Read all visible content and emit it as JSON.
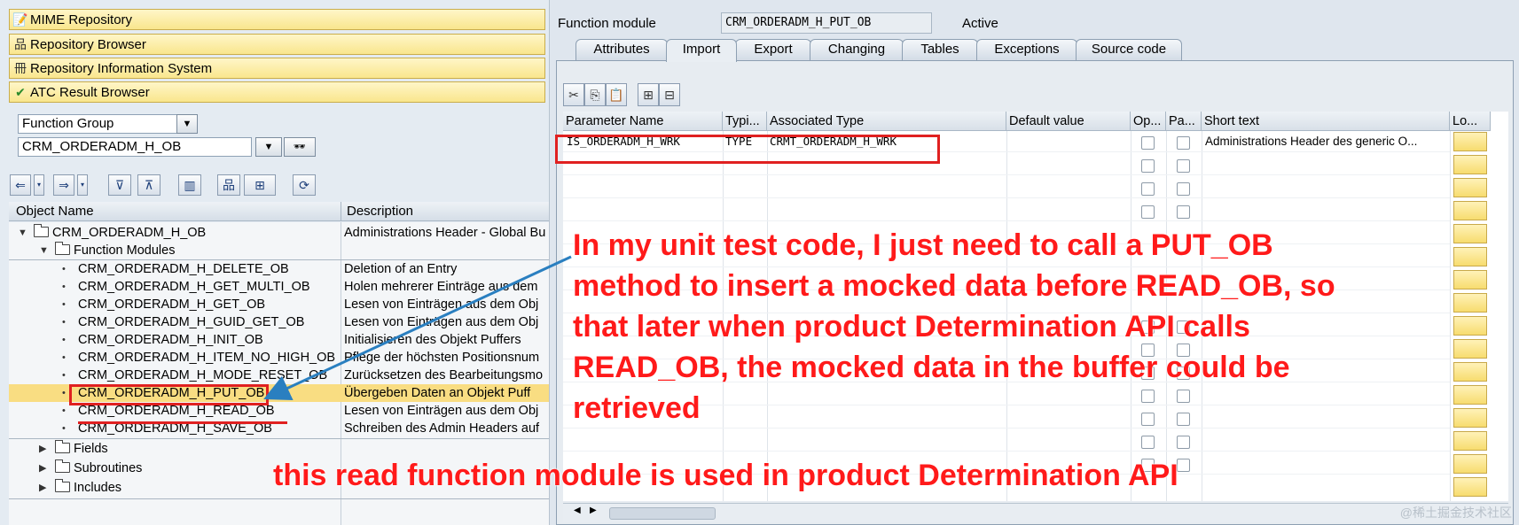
{
  "nav": {
    "items": [
      {
        "label": "MIME Repository",
        "icon": "mime-repository-icon",
        "glyph": "📝"
      },
      {
        "label": "Repository Browser",
        "icon": "repository-browser-icon",
        "glyph": "品"
      },
      {
        "label": "Repository Information System",
        "icon": "repository-info-system-icon",
        "glyph": "冊"
      },
      {
        "label": "ATC Result Browser",
        "icon": "atc-result-icon",
        "glyph": "✔"
      }
    ]
  },
  "object_selector": {
    "type_value": "Function Group",
    "name_value": "CRM_ORDERADM_H_OB",
    "display_glyph": "🕶"
  },
  "tree_toolbar": {
    "buttons": [
      "⇐",
      "⇒",
      "⊽",
      "⊼",
      "▥",
      "品",
      "⊞",
      "⟳"
    ]
  },
  "tree": {
    "header": {
      "col1": "Object Name",
      "col2": "Description"
    },
    "root": {
      "name": "CRM_ORDERADM_H_OB",
      "desc": "Administrations Header - Global Bu"
    },
    "fm_folder": {
      "name": "Function Modules"
    },
    "modules": [
      {
        "name": "CRM_ORDERADM_H_DELETE_OB",
        "desc": "Deletion of an Entry"
      },
      {
        "name": "CRM_ORDERADM_H_GET_MULTI_OB",
        "desc": "Holen mehrerer Einträge aus dem"
      },
      {
        "name": "CRM_ORDERADM_H_GET_OB",
        "desc": "Lesen von Einträgen aus dem Obj"
      },
      {
        "name": "CRM_ORDERADM_H_GUID_GET_OB",
        "desc": "Lesen von Einträgen aus dem Obj"
      },
      {
        "name": "CRM_ORDERADM_H_INIT_OB",
        "desc": "Initialisieren des Objekt Puffers"
      },
      {
        "name": "CRM_ORDERADM_H_ITEM_NO_HIGH_OB",
        "desc": "Pflege der höchsten Positionsnum"
      },
      {
        "name": "CRM_ORDERADM_H_MODE_RESET_OB",
        "desc": "Zurücksetzen des Bearbeitungsmo"
      },
      {
        "name": "CRM_ORDERADM_H_PUT_OB",
        "desc": "Übergeben Daten an Objekt Puff"
      },
      {
        "name": "CRM_ORDERADM_H_READ_OB",
        "desc": "Lesen von Einträgen aus dem Obj"
      },
      {
        "name": "CRM_ORDERADM_H_SAVE_OB",
        "desc": "Schreiben des Admin Headers auf"
      }
    ],
    "other_folders": [
      "Fields",
      "Subroutines",
      "Includes"
    ]
  },
  "function_module": {
    "label": "Function module",
    "value": "CRM_ORDERADM_H_PUT_OB",
    "status": "Active"
  },
  "tabs": [
    "Attributes",
    "Import",
    "Export",
    "Changing",
    "Tables",
    "Exceptions",
    "Source code"
  ],
  "grid_toolbar": [
    "✂",
    "⎘",
    "📋",
    "⊞",
    "⊟"
  ],
  "grid": {
    "columns": [
      "Parameter Name",
      "Typi...",
      "Associated Type",
      "Default value",
      "Op...",
      "Pa...",
      "Short text",
      "Lo..."
    ],
    "rows": [
      {
        "param": "IS_ORDERADM_H_WRK",
        "typing": "TYPE",
        "assoc": "CRMT_ORDERADM_H_WRK",
        "default": "",
        "short": "Administrations Header des generic O..."
      }
    ]
  },
  "annotations": {
    "main_lines": [
      "In my unit test code, I just need to call a PUT_OB",
      "method to insert a mocked data before READ_OB, so",
      "that later when product Determination API calls",
      "READ_OB, the mocked data in the buffer could be",
      "retrieved"
    ],
    "bottom": "this read function module is used in product Determination API"
  },
  "colors": {
    "annotation_red": "#ff1a1a",
    "nav_yellow": "#f9e68d",
    "selection_yellow": "#f9dd82",
    "arrow_blue": "#2a7fc0"
  },
  "watermark": "@稀土掘金技术社区"
}
